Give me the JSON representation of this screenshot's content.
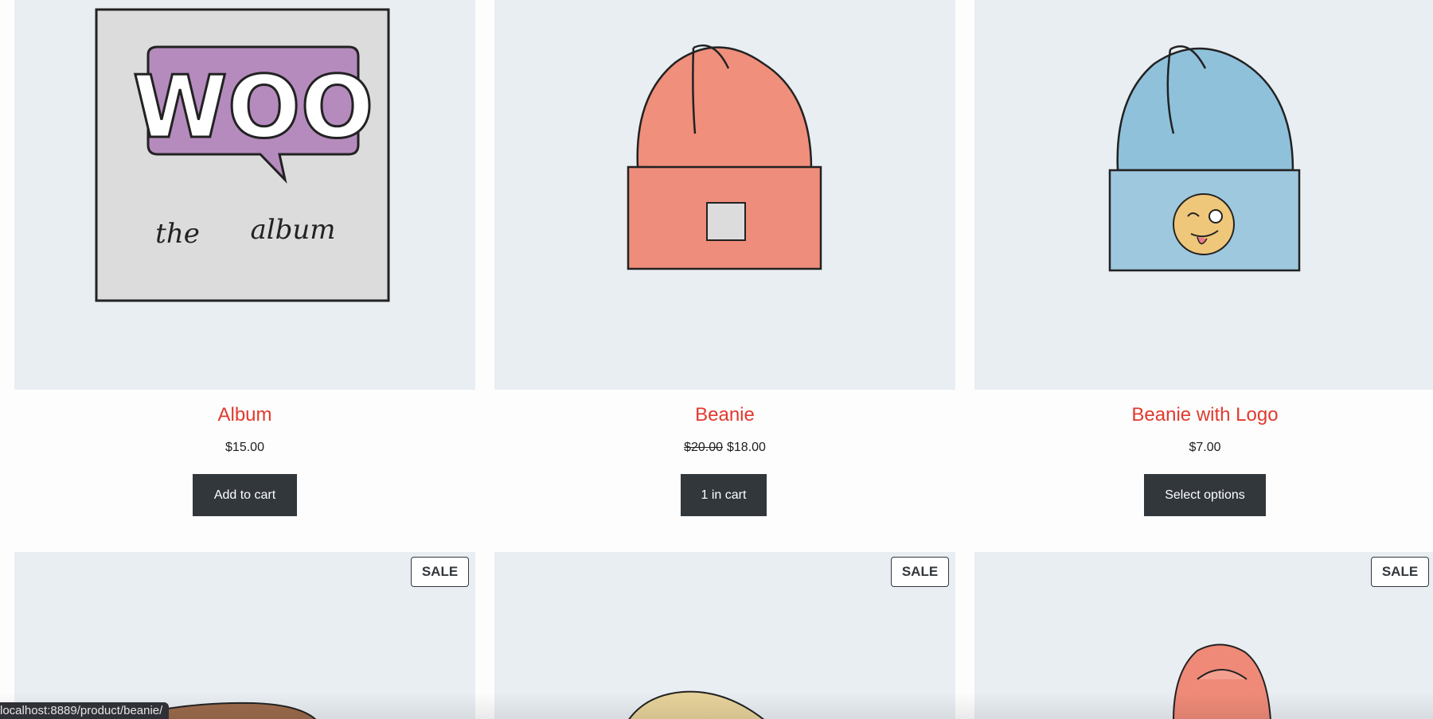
{
  "products": [
    {
      "name": "Album",
      "price": "$15.00",
      "button_label": "Add to cart",
      "image_icon": "album-image",
      "cover_text": "WOO",
      "cover_caption_left": "the",
      "cover_caption_right": "album"
    },
    {
      "name": "Beanie",
      "old_price": "$20.00",
      "price": "$18.00",
      "button_label": "1 in cart",
      "image_icon": "beanie-image"
    },
    {
      "name": "Beanie with Logo",
      "price": "$7.00",
      "button_label": "Select options",
      "image_icon": "beanie-logo-image"
    }
  ],
  "second_row": [
    {
      "badge": "SALE",
      "image_icon": "cap-image"
    },
    {
      "badge": "SALE",
      "image_icon": "cap-image"
    },
    {
      "badge": "SALE",
      "image_icon": "hoodie-image"
    }
  ],
  "status_bar": {
    "url": "localhost:8889/product/beanie/"
  },
  "colors": {
    "title": "#e03a2f",
    "button_bg": "#32373c",
    "thumb_bg": "#e9eef3"
  }
}
